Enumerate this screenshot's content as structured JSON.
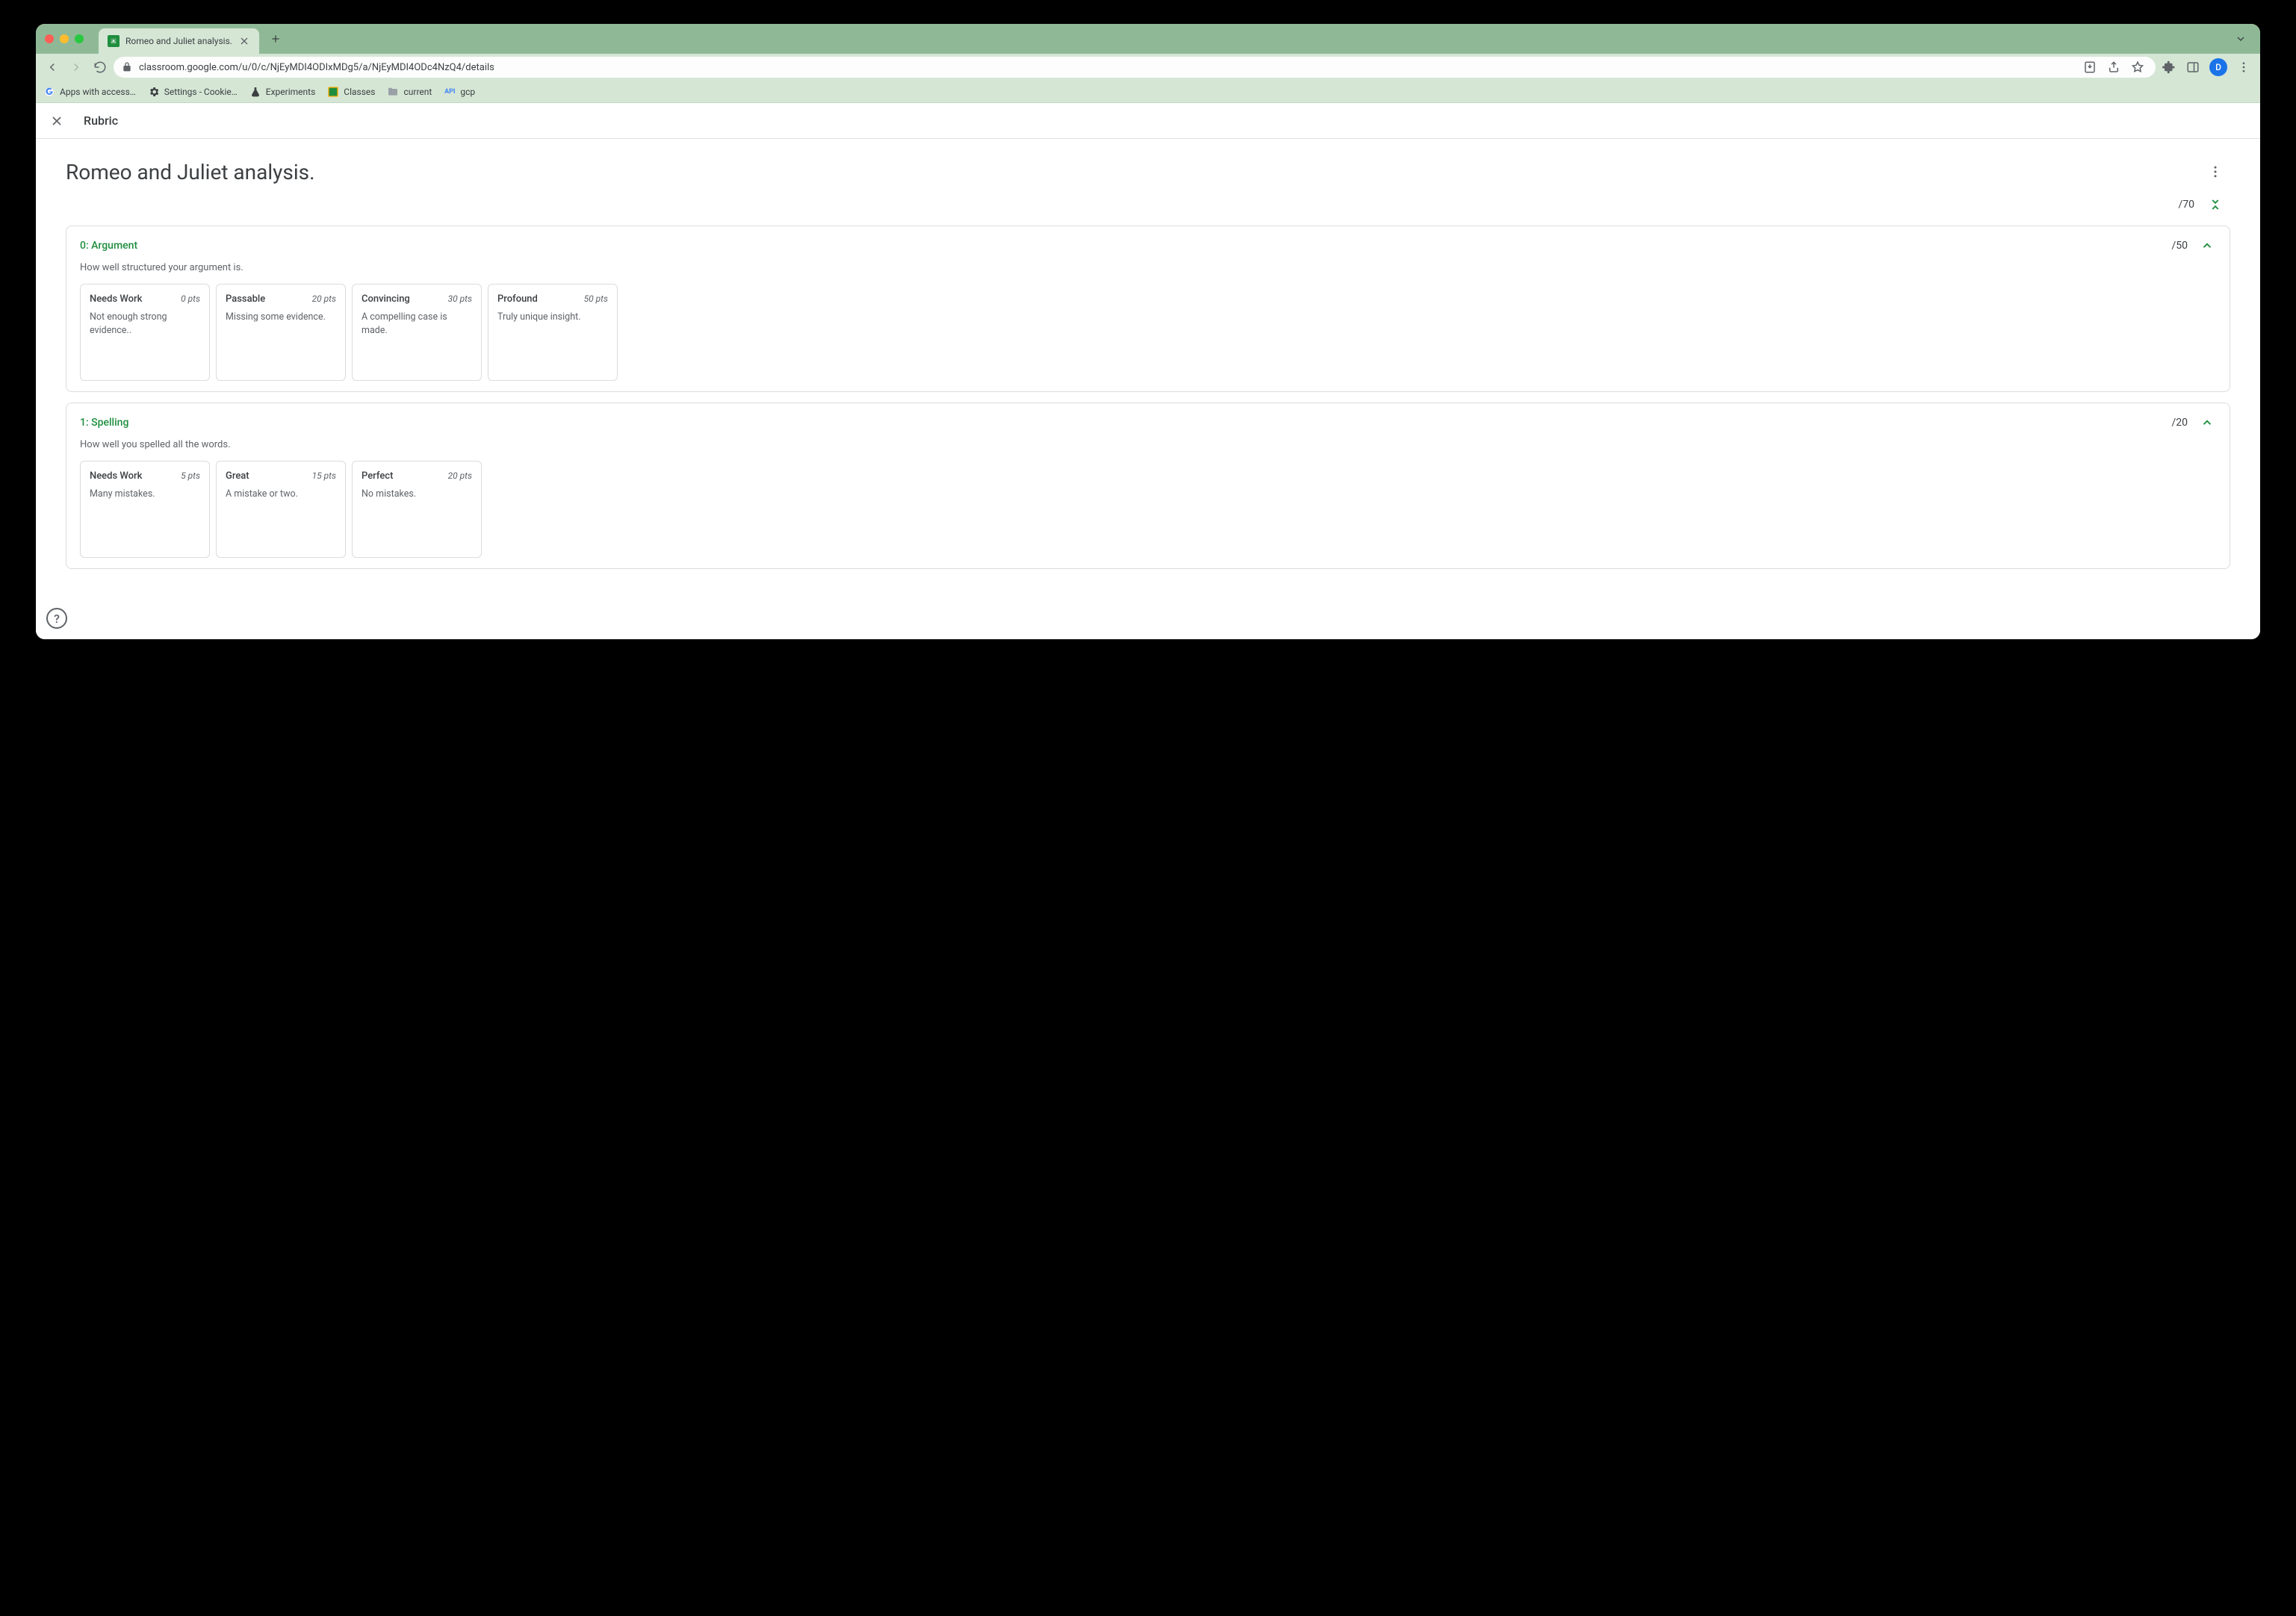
{
  "browser": {
    "tab_title": "Romeo and Juliet analysis.",
    "url": "classroom.google.com/u/0/c/NjEyMDI4ODIxMDg5/a/NjEyMDI4ODc4NzQ4/details",
    "avatar_letter": "D",
    "bookmarks": [
      {
        "label": "Apps with access…"
      },
      {
        "label": "Settings - Cookie…"
      },
      {
        "label": "Experiments"
      },
      {
        "label": "Classes"
      },
      {
        "label": "current"
      },
      {
        "label": "gcp",
        "prefix": "API"
      }
    ]
  },
  "header": {
    "section_label": "Rubric"
  },
  "assignment": {
    "title": "Romeo and Juliet analysis.",
    "total_points": "/70"
  },
  "criteria": [
    {
      "title": "0: Argument",
      "points": "/50",
      "description": "How well structured your argument is.",
      "levels": [
        {
          "name": "Needs Work",
          "pts": "0 pts",
          "desc": "Not enough strong evidence.."
        },
        {
          "name": "Passable",
          "pts": "20 pts",
          "desc": "Missing some evidence."
        },
        {
          "name": "Convincing",
          "pts": "30 pts",
          "desc": "A compelling case is made."
        },
        {
          "name": "Profound",
          "pts": "50 pts",
          "desc": "Truly unique insight."
        }
      ]
    },
    {
      "title": "1: Spelling",
      "points": "/20",
      "description": "How well you spelled all the words.",
      "levels": [
        {
          "name": "Needs Work",
          "pts": "5 pts",
          "desc": "Many mistakes."
        },
        {
          "name": "Great",
          "pts": "15 pts",
          "desc": "A mistake or two."
        },
        {
          "name": "Perfect",
          "pts": "20 pts",
          "desc": "No mistakes."
        }
      ]
    }
  ]
}
